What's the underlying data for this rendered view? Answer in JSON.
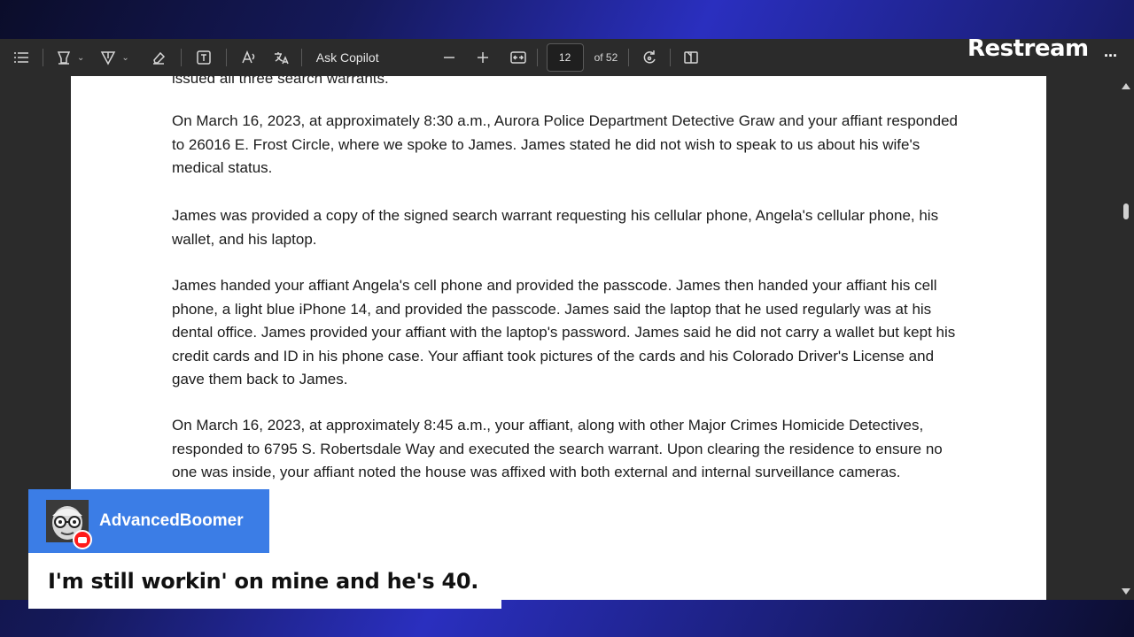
{
  "toolbar": {
    "ask_copilot": "Ask Copilot",
    "page_number": "12",
    "page_of": "of 52"
  },
  "document": {
    "top_partial": "issued all three search warrants.",
    "paragraphs": [
      "On March 16, 2023, at approximately 8:30 a.m., Aurora Police Department Detective Graw and your affiant responded to 26016 E. Frost Circle, where we spoke to James. James stated he did not wish to speak to us about his wife's medical status.",
      "James was provided a copy of the signed search warrant requesting his cellular phone, Angela's cellular phone, his wallet, and his laptop.",
      "James handed your affiant Angela's cell phone and provided the passcode. James then handed your affiant his cell phone, a light blue iPhone 14, and provided the passcode. James said the laptop that he used regularly was at his dental office. James provided your affiant with the laptop's password. James said he did not carry a wallet but kept his credit cards and ID in his phone case. Your affiant took pictures of the cards and his Colorado Driver's License and gave them back to James.",
      "On March 16, 2023, at approximately 8:45 a.m., your affiant, along with other Major Crimes Homicide Detectives, responded to 6795 S. Robertsdale Way and executed the search warrant. Upon clearing the residence to ensure no one was inside, your affiant noted the house was affixed with both external and internal surveillance cameras."
    ]
  },
  "overlay": {
    "brand": "Restream",
    "more": "...",
    "chat": {
      "username": "AdvancedBoomer",
      "message": "I'm still workin' on mine and he's 40."
    }
  },
  "colors": {
    "chat_header": "#3b7de6",
    "youtube_badge": "#ff1a1a",
    "toolbar_bg": "#2b2b2b"
  }
}
